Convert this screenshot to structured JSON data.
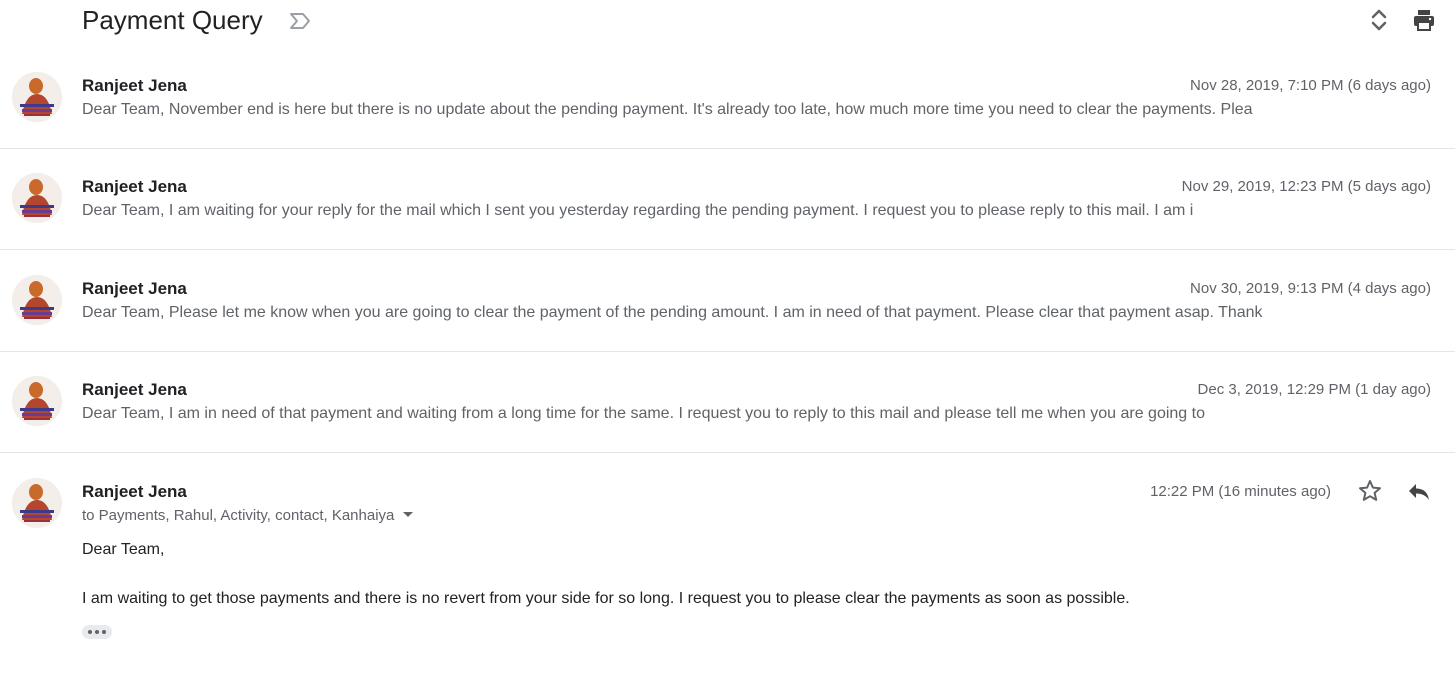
{
  "thread": {
    "subject": "Payment Query",
    "icons": {
      "label": "label-tag-icon",
      "expand": "expand-collapse-icon",
      "print": "print-icon"
    }
  },
  "messages": [
    {
      "sender": "Ranjeet Jena",
      "date": "Nov 28, 2019, 7:10 PM (6 days ago)",
      "snippet": "Dear Team, November end is here but there is no update about the pending payment. It's already too late, how much more time you need to clear the payments. Plea"
    },
    {
      "sender": "Ranjeet Jena",
      "date": "Nov 29, 2019, 12:23 PM (5 days ago)",
      "snippet": "Dear Team, I am waiting for your reply for the mail which I sent you yesterday regarding the pending payment. I request you to please reply to this mail. I am i"
    },
    {
      "sender": "Ranjeet Jena",
      "date": "Nov 30, 2019, 9:13 PM (4 days ago)",
      "snippet": "Dear Team, Please let me know when you are going to clear the payment of the pending amount. I am in need of that payment. Please clear that payment asap. Thank"
    },
    {
      "sender": "Ranjeet Jena",
      "date": "Dec 3, 2019, 12:29 PM (1 day ago)",
      "snippet": "Dear Team, I am in need of that payment and waiting from a long time for the same. I request you to reply to this mail and please tell me when you are going to"
    }
  ],
  "expanded": {
    "sender": "Ranjeet Jena",
    "date": "12:22 PM (16 minutes ago)",
    "recipients": "to Payments, Rahul, Activity, contact, Kanhaiya",
    "greeting": "Dear Team,",
    "body": "I am waiting to get those payments and there is no revert from your side for so long. I request you to please clear the payments as soon as possible.",
    "icons": {
      "star": "star-icon",
      "reply": "reply-icon",
      "more": "more-horizontal-icon"
    }
  }
}
